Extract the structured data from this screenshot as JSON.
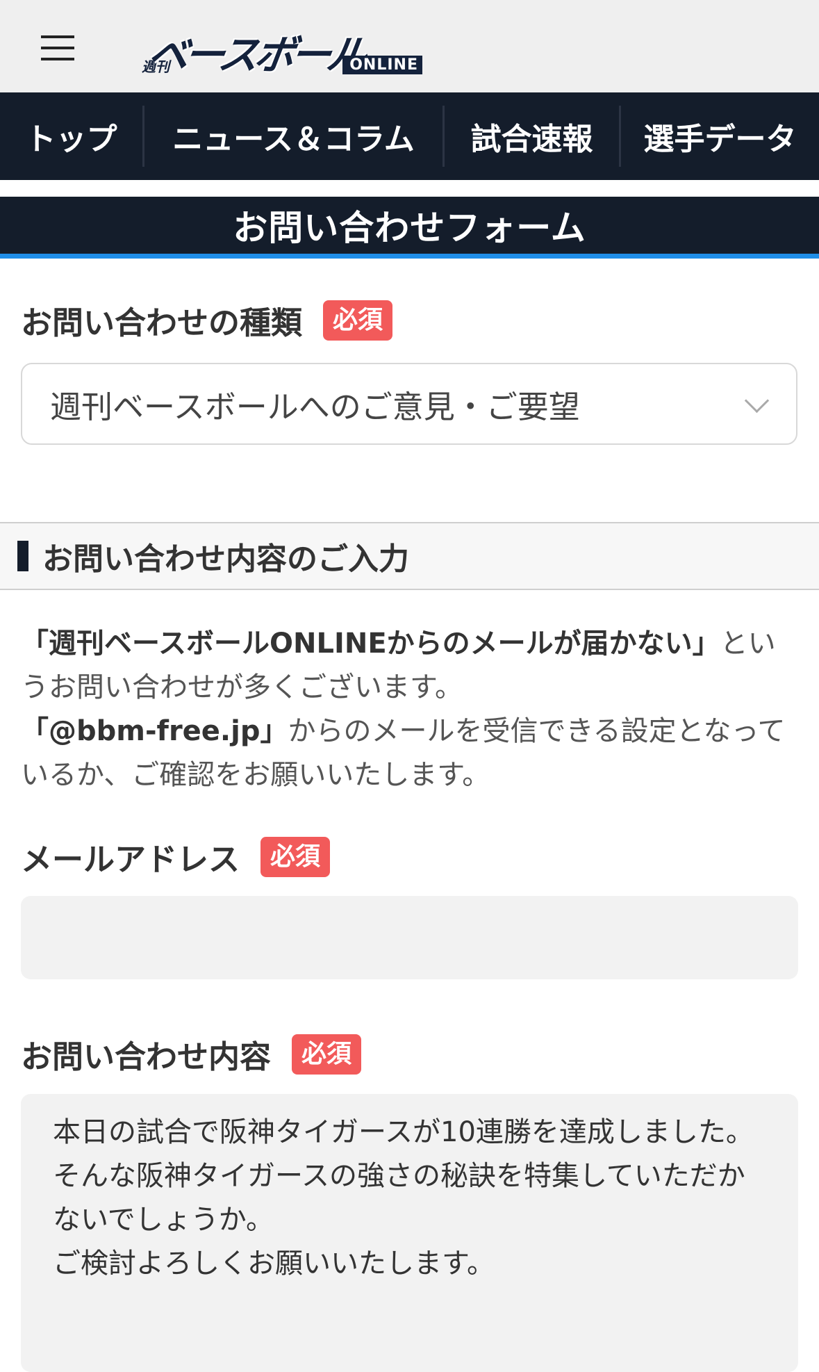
{
  "header": {
    "logo_small": "週刊",
    "logo_main": "ベースボール",
    "logo_online": "ONLINE"
  },
  "nav": {
    "items": [
      {
        "label": "トップ"
      },
      {
        "label": "ニュース＆コラム"
      },
      {
        "label": "試合速報"
      },
      {
        "label": "選手データ"
      }
    ]
  },
  "page": {
    "title": "お問い合わせフォーム"
  },
  "inquiry_type": {
    "label": "お問い合わせの種類",
    "required": "必須",
    "selected": "週刊ベースボールへのご意見・ご要望"
  },
  "section": {
    "heading": "お問い合わせ内容のご入力"
  },
  "notice": {
    "quote1": "「週刊ベースボールONLINEからのメールが届かない」",
    "text1": "というお問い合わせが多くございます。",
    "quote2": "「@bbm-free.jp」",
    "text2": "からのメールを受信できる設定となっているか、ご確認をお願いいたします。"
  },
  "email": {
    "label": "メールアドレス",
    "required": "必須",
    "value": ""
  },
  "message": {
    "label": "お問い合わせ内容",
    "required": "必須",
    "value": "本日の試合で阪神タイガースが10連勝を達成しました。\nそんな阪神タイガースの強さの秘訣を特集していただかないでしょうか。\nご検討よろしくお願いいたします。"
  }
}
